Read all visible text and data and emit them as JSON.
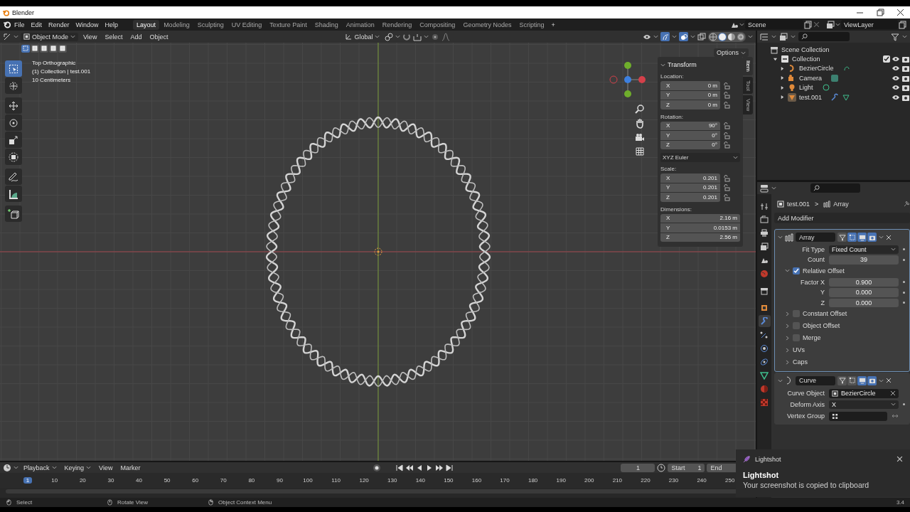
{
  "window": {
    "title": "Blender"
  },
  "menus": [
    "File",
    "Edit",
    "Render",
    "Window",
    "Help"
  ],
  "workspaces": [
    {
      "label": "Layout",
      "selected": true
    },
    {
      "label": "Modeling",
      "selected": false
    },
    {
      "label": "Sculpting",
      "selected": false
    },
    {
      "label": "UV Editing",
      "selected": false
    },
    {
      "label": "Texture Paint",
      "selected": false
    },
    {
      "label": "Shading",
      "selected": false
    },
    {
      "label": "Animation",
      "selected": false
    },
    {
      "label": "Rendering",
      "selected": false
    },
    {
      "label": "Compositing",
      "selected": false
    },
    {
      "label": "Geometry Nodes",
      "selected": false
    },
    {
      "label": "Scripting",
      "selected": false
    }
  ],
  "add_workspace": "+",
  "scene": "Scene",
  "view_layer": "ViewLayer",
  "viewport": {
    "mode": "Object Mode",
    "menus": [
      "View",
      "Select",
      "Add",
      "Object"
    ],
    "orientation": "Global",
    "options": "Options",
    "gizmos_on": true,
    "overlays_on": true,
    "shading": [
      {
        "kind": "wireframe",
        "selected": false
      },
      {
        "kind": "solid",
        "selected": true
      },
      {
        "kind": "material",
        "selected": false
      },
      {
        "kind": "rendered",
        "selected": false
      }
    ],
    "select_modes": [
      {
        "selected": true
      },
      {
        "selected": false
      },
      {
        "selected": false
      },
      {
        "selected": false
      },
      {
        "selected": false
      }
    ],
    "overlay_lines": [
      "Top Orthographic",
      "(1) Collection | test.001",
      "10 Centimeters"
    ],
    "tools": [
      {
        "kind": "select-box",
        "selected": true
      },
      {
        "kind": "cursor",
        "selected": false
      },
      {
        "kind": "move",
        "selected": false
      },
      {
        "kind": "rotate",
        "selected": false
      },
      {
        "kind": "scale",
        "selected": false
      },
      {
        "kind": "transform",
        "selected": false
      },
      {
        "kind": "annotate",
        "selected": false
      },
      {
        "kind": "measure",
        "selected": false
      },
      {
        "kind": "add-cube",
        "selected": false
      }
    ],
    "sidebar_tabs": [
      {
        "label": "Item",
        "selected": true
      },
      {
        "label": "Tool",
        "selected": false
      },
      {
        "label": "View",
        "selected": false
      }
    ],
    "transform": {
      "title": "Transform",
      "rotation_mode": "XYZ Euler",
      "groups": [
        {
          "label": "Location:",
          "fields": [
            {
              "axis": "X",
              "value": "0 m",
              "locked": false
            },
            {
              "axis": "Y",
              "value": "0 m",
              "locked": false
            },
            {
              "axis": "Z",
              "value": "0 m",
              "locked": false
            }
          ]
        },
        {
          "label": "Rotation:",
          "fields": [
            {
              "axis": "X",
              "value": "90°",
              "locked": false
            },
            {
              "axis": "Y",
              "value": "0°",
              "locked": false
            },
            {
              "axis": "Z",
              "value": "0°",
              "locked": false
            }
          ]
        },
        {
          "label": "Scale:",
          "fields": [
            {
              "axis": "X",
              "value": "0.201",
              "locked": false
            },
            {
              "axis": "Y",
              "value": "0.201",
              "locked": false
            },
            {
              "axis": "Z",
              "value": "0.201",
              "locked": false
            }
          ]
        },
        {
          "label": "Dimensions:",
          "fields": [
            {
              "axis": "X",
              "value": "2.16 m"
            },
            {
              "axis": "Y",
              "value": "0.0153 m"
            },
            {
              "axis": "Z",
              "value": "2.56 m"
            }
          ]
        }
      ]
    }
  },
  "outliner": {
    "root": "Scene Collection",
    "collections": [
      {
        "name": "Collection",
        "expanded": true,
        "checked": true,
        "children": [
          {
            "name": "BezierCircle",
            "kind": "curve"
          },
          {
            "name": "Camera",
            "kind": "camera"
          },
          {
            "name": "Light",
            "kind": "light"
          },
          {
            "name": "test.001",
            "kind": "mesh"
          }
        ]
      }
    ]
  },
  "properties": {
    "object": "test.001",
    "modifier": "Array",
    "separator": ">",
    "add_modifier": "Add Modifier",
    "tabs": [
      {
        "kind": "tool",
        "selected": false
      },
      {
        "kind": "render",
        "selected": false
      },
      {
        "kind": "output",
        "selected": false
      },
      {
        "kind": "view-layer",
        "selected": false
      },
      {
        "kind": "scene",
        "selected": false
      },
      {
        "kind": "world",
        "selected": false
      },
      {
        "kind": "collection",
        "selected": false
      },
      {
        "kind": "object",
        "selected": false
      },
      {
        "kind": "modifier",
        "selected": true
      },
      {
        "kind": "particles",
        "selected": false
      },
      {
        "kind": "physics",
        "selected": false
      },
      {
        "kind": "constraints",
        "selected": false
      },
      {
        "kind": "data",
        "selected": false
      },
      {
        "kind": "material",
        "selected": false
      },
      {
        "kind": "texture",
        "selected": false
      }
    ],
    "modifiers": [
      {
        "kind": "array",
        "name": "Array",
        "expanded": true,
        "active": true,
        "toggles": [
          {
            "kind": "on-cage",
            "on": false
          },
          {
            "kind": "edit-mode",
            "on": true
          },
          {
            "kind": "viewport",
            "on": true
          },
          {
            "kind": "render",
            "on": true
          }
        ],
        "rows": [
          {
            "kind": "dropdown",
            "label": "Fit Type",
            "value": "Fixed Count"
          },
          {
            "kind": "number",
            "label": "Count",
            "value": "39"
          },
          {
            "kind": "check-subpanel",
            "label": "Relative Offset",
            "checked": true,
            "expanded": true,
            "rows": [
              {
                "kind": "number",
                "label": "Factor X",
                "value": "0.900"
              },
              {
                "kind": "number",
                "label": "Y",
                "value": "0.000"
              },
              {
                "kind": "number",
                "label": "Z",
                "value": "0.000"
              }
            ]
          },
          {
            "kind": "check-subpanel",
            "label": "Constant Offset",
            "checked": false,
            "expanded": false
          },
          {
            "kind": "check-subpanel",
            "label": "Object Offset",
            "checked": false,
            "expanded": false
          },
          {
            "kind": "check-subpanel",
            "label": "Merge",
            "checked": false,
            "expanded": false
          },
          {
            "kind": "subpanel",
            "label": "UVs",
            "expanded": false
          },
          {
            "kind": "subpanel",
            "label": "Caps",
            "expanded": false
          }
        ]
      },
      {
        "kind": "curve",
        "name": "Curve",
        "expanded": true,
        "active": false,
        "toggles": [
          {
            "kind": "on-cage",
            "on": false
          },
          {
            "kind": "edit-mode",
            "on": false
          },
          {
            "kind": "viewport",
            "on": true
          },
          {
            "kind": "render",
            "on": true
          }
        ],
        "rows": [
          {
            "kind": "object",
            "label": "Curve Object",
            "value": "BezierCircle"
          },
          {
            "kind": "dropdown",
            "label": "Deform Axis",
            "value": "X"
          },
          {
            "kind": "group",
            "label": "Vertex Group"
          }
        ]
      }
    ]
  },
  "timeline": {
    "menus": [
      "Playback",
      "Keying",
      "View",
      "Marker"
    ],
    "current_frame": "1",
    "start_label": "Start",
    "start": "1",
    "end_label": "End",
    "ticks": [
      {
        "label": "1",
        "selected": true
      },
      {
        "label": "10",
        "selected": false
      },
      {
        "label": "20",
        "selected": false
      },
      {
        "label": "30",
        "selected": false
      },
      {
        "label": "40",
        "selected": false
      },
      {
        "label": "50",
        "selected": false
      },
      {
        "label": "60",
        "selected": false
      },
      {
        "label": "70",
        "selected": false
      },
      {
        "label": "80",
        "selected": false
      },
      {
        "label": "90",
        "selected": false
      },
      {
        "label": "100",
        "selected": false
      },
      {
        "label": "110",
        "selected": false
      },
      {
        "label": "120",
        "selected": false
      },
      {
        "label": "130",
        "selected": false
      },
      {
        "label": "140",
        "selected": false
      },
      {
        "label": "150",
        "selected": false
      },
      {
        "label": "160",
        "selected": false
      },
      {
        "label": "170",
        "selected": false
      },
      {
        "label": "180",
        "selected": false
      },
      {
        "label": "190",
        "selected": false
      },
      {
        "label": "200",
        "selected": false
      },
      {
        "label": "210",
        "selected": false
      },
      {
        "label": "220",
        "selected": false
      },
      {
        "label": "230",
        "selected": false
      },
      {
        "label": "240",
        "selected": false
      },
      {
        "label": "250",
        "selected": false
      }
    ]
  },
  "status_bar": {
    "hints": [
      {
        "kind": "mouse-left",
        "label": "Select"
      },
      {
        "kind": "mouse-middle",
        "label": "Rotate View"
      },
      {
        "kind": "mouse-right",
        "label": "Object Context Menu"
      }
    ],
    "version": "3.4"
  },
  "notification": {
    "app": "Lightshot",
    "title": "Lightshot",
    "message": "Your screenshot is copied to clipboard"
  }
}
